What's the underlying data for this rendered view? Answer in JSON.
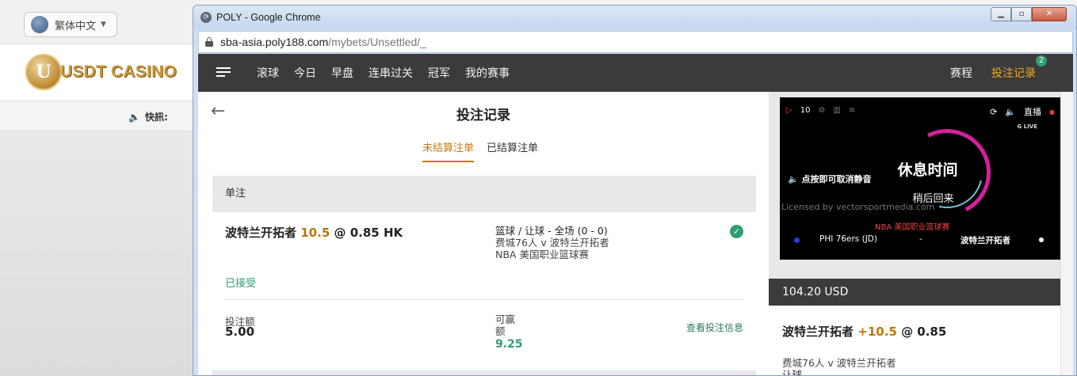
{
  "background_site": {
    "language": "繁体中文",
    "logo_text": "USDT CASINO",
    "logo_letter": "U",
    "news_label": "快訊:"
  },
  "browser": {
    "title": "POLY - Google Chrome",
    "url_domain": "sba-asia.poly188.com",
    "url_path": "/mybets/Unsettled/_"
  },
  "nav": {
    "items": [
      "滚球",
      "今日",
      "早盘",
      "连串过关",
      "冠军",
      "我的赛事"
    ],
    "schedule": "赛程",
    "bet_records": "投注记录",
    "bet_badge": "2"
  },
  "main": {
    "title": "投注记录",
    "tabs": [
      "未结算注单",
      "已结算注单"
    ],
    "active_tab": "未结算注单",
    "section": "单注",
    "bet": {
      "team": "波特兰开拓者",
      "handicap": "10.5",
      "at": "@",
      "odds": "0.85 HK",
      "market": "篮球 / 让球 - 全场 (0 - 0)",
      "match": "费城76人 v 波特兰开拓者",
      "league": "NBA 美国职业篮球赛",
      "status": "已接受",
      "stake_label": "投注额",
      "stake": "5.00",
      "win_label": "可赢额",
      "win": "9.25",
      "view_info": "查看投注信息"
    }
  },
  "video": {
    "ctrl_score": "10",
    "live_label": "直播",
    "glive": "G LIVE",
    "mute_hint": "点按即可取消静音",
    "break_title": "休息时间",
    "break_sub": "稍后回来",
    "watermark": "Licensed by vectorsportmedia.com",
    "league": "NBA 美国职业篮球赛",
    "team_a": "PHI 76ers (JD)",
    "dash": "-",
    "team_b": "波特兰开拓者"
  },
  "slip": {
    "balance": "104.20 USD",
    "team": "波特兰开拓者",
    "handicap": "+10.5",
    "at": "@",
    "odds": "0.85",
    "match": "费城76人 v 波特兰开拓者",
    "market": "让球"
  }
}
